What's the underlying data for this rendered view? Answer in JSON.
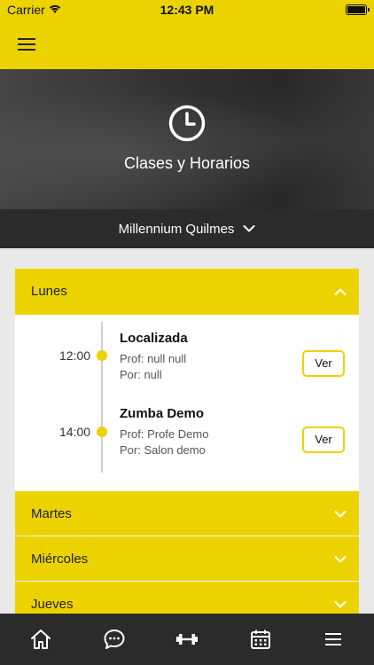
{
  "status_bar": {
    "carrier": "Carrier",
    "time": "12:43 PM"
  },
  "hero": {
    "title": "Clases y Horarios",
    "icon": "clock-icon"
  },
  "location": {
    "selected": "Millennium Quilmes"
  },
  "days": [
    {
      "label": "Lunes",
      "expanded": true,
      "classes": [
        {
          "time": "12:00",
          "name": "Localizada",
          "prof": "Prof: null null",
          "place": "Por: null",
          "button": "Ver"
        },
        {
          "time": "14:00",
          "name": "Zumba Demo",
          "prof": "Prof: Profe Demo",
          "place": "Por: Salon demo",
          "button": "Ver"
        }
      ]
    },
    {
      "label": "Martes",
      "expanded": false
    },
    {
      "label": "Miércoles",
      "expanded": false
    },
    {
      "label": "Jueves",
      "expanded": false
    }
  ],
  "tabs": [
    "home-icon",
    "chat-icon",
    "dumbbell-icon",
    "calendar-icon",
    "menu-icon"
  ],
  "colors": {
    "accent": "#ecd300",
    "dark": "#2b2b2b"
  }
}
